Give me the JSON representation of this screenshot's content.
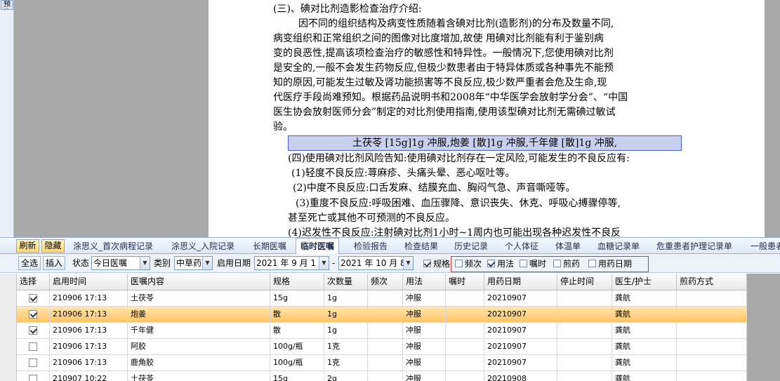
{
  "left_panel": {
    "tab_label": "预览"
  },
  "document": {
    "lines": [
      "(三)、碘对比剂造影检查治疗介绍:",
      "因不同的组织结构及病变性质随着含碘对比剂(造影剂)的分布及数量不同,",
      "病变组织和正常组织之间的图像对比度增加,故使    用碘对比剂能有利于鉴别病",
      "变的良恶性,提高该项检查治疗的敏感性和特异性。一般情况下,您使用碘对比剂",
      "是安全的,一般不会发生药物反应,但极少数患者由于特异体质或各种事先不能预",
      "知的原因,可能发生过敏及肾功能损害等不良反应,极少数严重者会危及生命,现",
      "代医疗手段尚难预知。根据药品说明书和2008年“中华医学会放射学分会”、“中国",
      "医生协会放射医师分会”制定的对比剂使用指南,使用该型碘对比剂无需碘过敏试",
      "验。",
      "土茯苓 [15g]1g 冲服,炮姜 [散]1g 冲服,千年健 [散]1g 冲服,",
      "(四)使用碘对比剂风险告知:使用碘对比剂存在一定风险,可能发生的不良反应有:",
      "(1)轻度不良反应:荨麻疹、头痛头晕、恶心呕吐等。",
      "(2)中度不良反应:口舌发麻、结膜充血、胸闷气急、声音嘶哑等。",
      "(3)重度不良反应:呼吸困难、血压骤降、意识丧失、休克、呼吸心搏骤停等,",
      "甚至死亡或其他不可预测的不良反应。",
      "(4)迟发性不良反应:注射碘对比剂1小时~1周内也可能出现各种迟发性不良反"
    ]
  },
  "tabs": {
    "refresh": "刷新",
    "hide": "隐藏",
    "items": [
      "涂思义_首次病程记录",
      "涂思义_入院记录",
      "长期医嘱",
      "临时医嘱",
      "检验报告",
      "检查结果",
      "历史记录",
      "个人体征",
      "体温单",
      "血糖记录单",
      "危重患者护理记录单",
      "一般患者"
    ]
  },
  "toolbar": {
    "select_all": "全选",
    "insert": "插入",
    "status_label": "状态",
    "status_value": "今日医嘱",
    "category_label": "类别",
    "category_value": "中草药",
    "start_date_label": "启用日期",
    "date_from": "2021 年 9 月 1",
    "date_sep": "-",
    "date_to": "2021 年 10 月 8",
    "options": [
      {
        "label": "规格",
        "checked": true
      },
      {
        "label": "频次",
        "checked": false
      },
      {
        "label": "用法",
        "checked": true
      },
      {
        "label": "嘱时",
        "checked": false
      },
      {
        "label": "煎药",
        "checked": false
      },
      {
        "label": "用药日期",
        "checked": false
      }
    ]
  },
  "table": {
    "headers": [
      "选择",
      "启用时间",
      "医嘱内容",
      "规格",
      "次数量",
      "频次",
      "用法",
      "嘱时",
      "用药日期",
      "停止时间",
      "医生/护士",
      "煎药方式"
    ],
    "rows": [
      {
        "checked": true,
        "cells": [
          "210906 17:13",
          "土茯苓",
          "15g",
          "1g",
          "",
          "冲服",
          "",
          "20210907",
          "",
          "龚航",
          ""
        ]
      },
      {
        "checked": true,
        "cells": [
          "210906 17:13",
          "炮姜",
          "散",
          "1g",
          "",
          "冲服",
          "",
          "20210907",
          "",
          "龚航",
          ""
        ]
      },
      {
        "checked": true,
        "cells": [
          "210906 17:13",
          "千年健",
          "散",
          "1g",
          "",
          "冲服",
          "",
          "20210907",
          "",
          "龚航",
          ""
        ]
      },
      {
        "checked": false,
        "cells": [
          "210906 17:13",
          "阿胶",
          "100g/瓶",
          "1克",
          "",
          "冲服",
          "",
          "20210907",
          "",
          "龚航",
          ""
        ]
      },
      {
        "checked": false,
        "cells": [
          "210906 17:13",
          "鹿角胶",
          "100g/瓶",
          "1克",
          "",
          "冲服",
          "",
          "20210907",
          "",
          "龚航",
          ""
        ]
      },
      {
        "checked": false,
        "cells": [
          "210907 10:22",
          "土茯苓",
          "15g",
          "2g",
          "",
          "冲服",
          "",
          "20210908",
          "",
          "龚航",
          ""
        ]
      }
    ]
  }
}
